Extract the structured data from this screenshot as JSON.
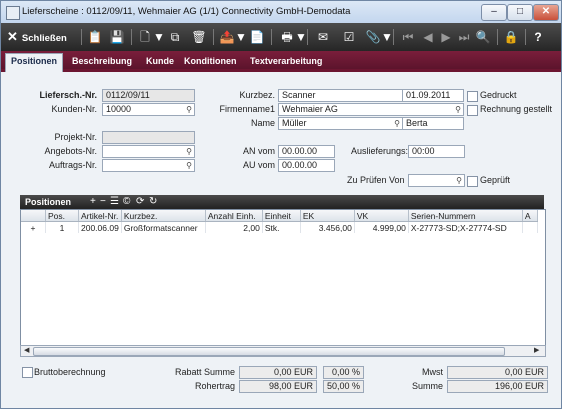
{
  "window": {
    "title": "Lieferscheine : 0112/09/11, Wehmaier AG (1/1) Connectivity GmbH-Demodata",
    "btn_min": "–",
    "btn_max": "□",
    "btn_close": "✕"
  },
  "toolbar": {
    "close_label": "Schließen",
    "close_icon": "✕",
    "icons": [
      "📋",
      "💾",
      "🗋",
      "⧉",
      "🗑",
      "📤",
      "📄",
      "🖶",
      "✉",
      "☑",
      "📎",
      "⏮",
      "◀",
      "▶",
      "⏭",
      "🔍",
      "🔒",
      "?"
    ]
  },
  "tabs": [
    "Positionen",
    "Beschreibung",
    "Kunde",
    "Konditionen",
    "Textverarbeitung"
  ],
  "form": {
    "lieferschein_label": "Liefersch.-Nr.",
    "lieferschein_value": "0112/09/11",
    "kunden_label": "Kunden-Nr.",
    "kunden_value": "10000",
    "projekt_label": "Projekt-Nr.",
    "projekt_value": "",
    "angebot_label": "Angebots-Nr.",
    "angebot_value": "",
    "auftrag_label": "Auftrags-Nr.",
    "auftrag_value": "",
    "kurzbez_label": "Kurzbez.",
    "kurzbez_value": "Scanner",
    "date_value": "01.09.2011",
    "firmenname_label": "Firmenname1",
    "firmenname_value": "Wehmaier AG",
    "name_label": "Name",
    "name_value": "Müller",
    "vorname_value": "Berta",
    "an_vom_label": "AN vom",
    "an_vom_value": "00.00.00",
    "au_vom_label": "AU vom",
    "au_vom_value": "00.00.00",
    "auslieferung_label": "Auslieferungs:",
    "auslieferung_value": "00:00",
    "zu_pruefen_label": "Zu Prüfen Von",
    "zu_pruefen_value": "",
    "gedruckt_label": "Gedruckt",
    "rechnung_label": "Rechnung gestellt",
    "geprueft_label": "Geprüft"
  },
  "positions": {
    "title": "Positionen",
    "columns": [
      "",
      "Pos.",
      "Artikel-Nr.",
      "Kurzbez.",
      "Anzahl Einh.",
      "Einheit",
      "EK",
      "VK",
      "Serien-Nummern",
      "A"
    ],
    "rows": [
      [
        "+",
        "1",
        "200.06.09",
        "Großformatscanner",
        "2,00",
        "Stk.",
        "3.456,00",
        "4.999,00",
        "X-27773-SD;X-27774-SD",
        ""
      ]
    ]
  },
  "footer": {
    "brutto_label": "Bruttoberechnung",
    "rabatt_label": "Rabatt Summe",
    "rabatt_value": "0,00 EUR",
    "rabatt_pct": "0,00 %",
    "rohertrag_label": "Rohertrag",
    "rohertrag_value": "98,00 EUR",
    "rohertrag_pct": "50,00 %",
    "mwst_label": "Mwst",
    "mwst_value": "0,00 EUR",
    "summe_label": "Summe",
    "summe_value": "196,00 EUR"
  }
}
